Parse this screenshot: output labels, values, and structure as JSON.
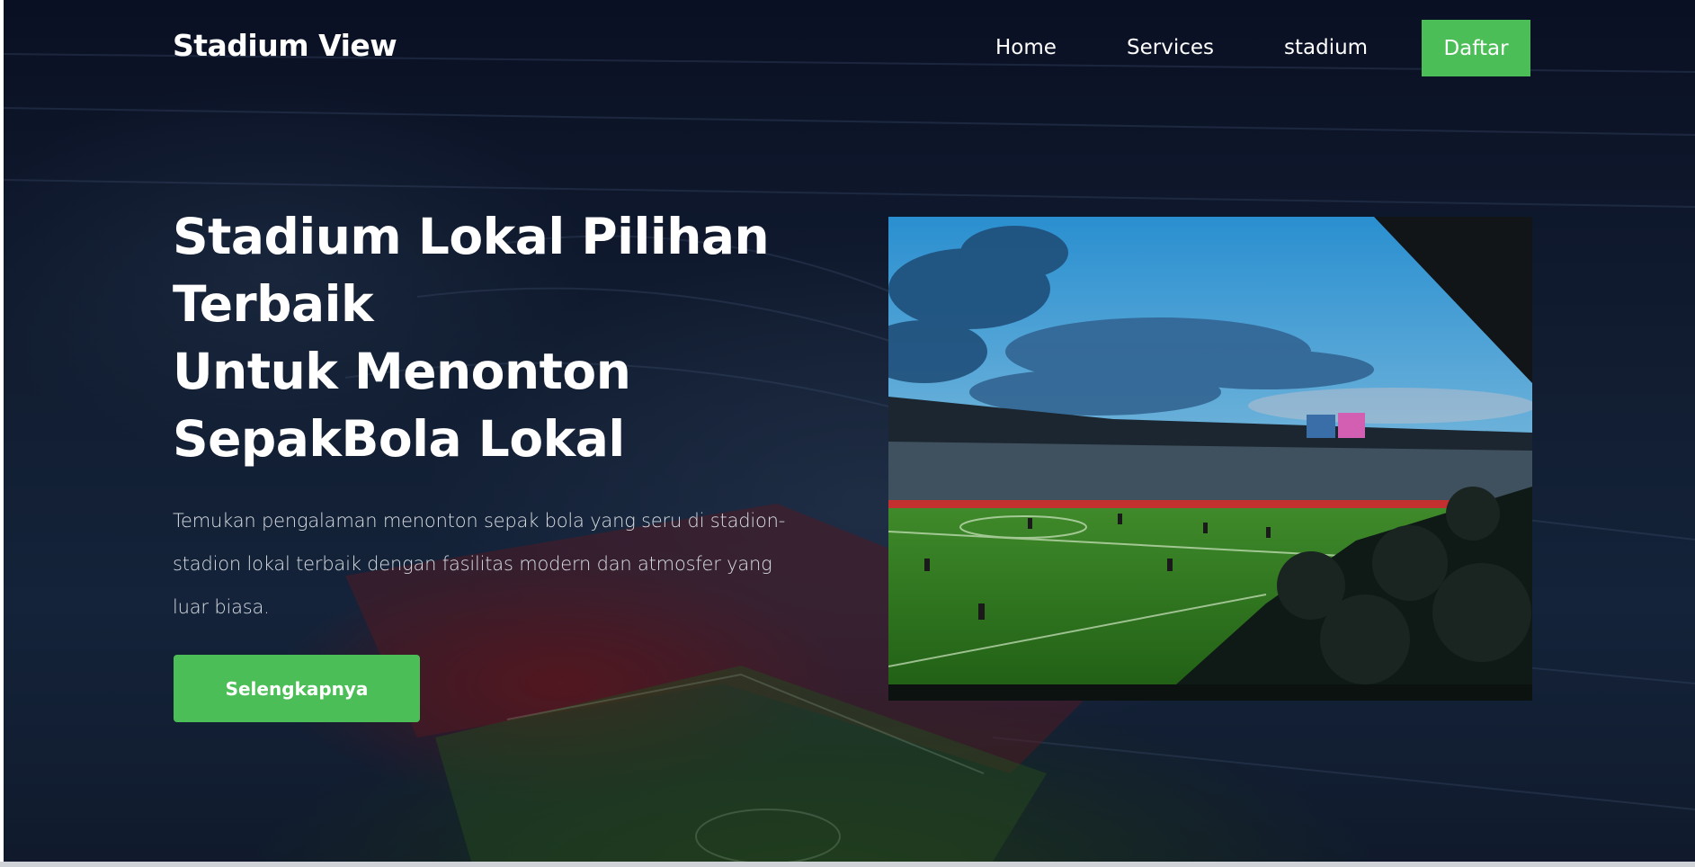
{
  "nav": {
    "brand": "Stadium View",
    "links": [
      "Home",
      "Services",
      "stadium"
    ],
    "cta_label": "Daftar"
  },
  "hero": {
    "headline_lines": [
      "Stadium Lokal Pilihan",
      "Terbaik",
      "Untuk Menonton",
      "SepakBola Lokal"
    ],
    "description": "Temukan pengalaman menonton sepak bola yang seru di stadion-stadion lokal terbaik dengan fasilitas modern dan atmosfer yang luar biasa.",
    "button_label": "Selengkapnya"
  },
  "colors": {
    "accent": "#4cbe58",
    "background": "#0d1628"
  }
}
